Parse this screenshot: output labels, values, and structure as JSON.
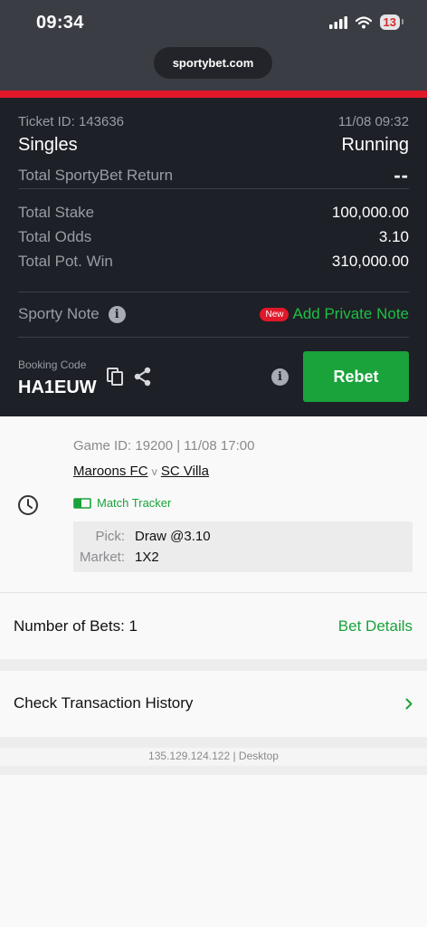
{
  "status_bar": {
    "time": "09:34",
    "battery": "13"
  },
  "browser": {
    "url": "sportybet.com"
  },
  "ticket": {
    "ticket_id": "Ticket ID: 143636",
    "datetime": "11/08 09:32",
    "bet_type": "Singles",
    "status": "Running",
    "return_label": "Total SportyBet Return",
    "return_value": "--",
    "stake_label": "Total Stake",
    "stake_value": "100,000.00",
    "odds_label": "Total Odds",
    "odds_value": "3.10",
    "potwin_label": "Total Pot. Win",
    "potwin_value": "310,000.00",
    "note_label": "Sporty Note",
    "new_badge": "New",
    "add_note": "Add Private Note",
    "booking_label": "Booking Code",
    "booking_code": "HA1EUW",
    "rebet_label": "Rebet"
  },
  "game": {
    "game_id": "Game ID: 19200 | 11/08 17:00",
    "home_team": "Maroons FC",
    "vs": "v",
    "away_team": "SC Villa",
    "tracker_label": "Match Tracker",
    "pick_label": "Pick:",
    "pick_value": "Draw @3.10",
    "market_label": "Market:",
    "market_value": "1X2"
  },
  "bets": {
    "number_label": "Number of Bets: 1",
    "details_link": "Bet Details"
  },
  "history": {
    "label": "Check Transaction History"
  },
  "footer": {
    "ip_info": "135.129.124.122 | Desktop"
  },
  "colors": {
    "brand_red": "#e0182a",
    "accent_green": "#1aa23b",
    "dark_panel": "#1e2027"
  }
}
